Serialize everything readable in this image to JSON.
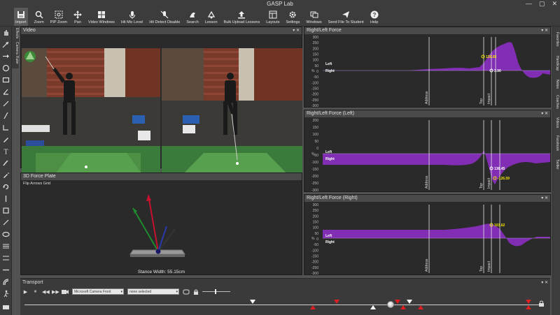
{
  "window": {
    "title": "GASP Lab",
    "controls": [
      "—",
      "▢",
      "✕"
    ]
  },
  "toolbar": {
    "items": [
      {
        "label": "Import",
        "icon": "save-icon"
      },
      {
        "label": "Zoom",
        "icon": "zoom-icon"
      },
      {
        "label": "PIP Zoom",
        "icon": "pip-zoom-icon"
      },
      {
        "label": "Pan",
        "icon": "pan-icon"
      },
      {
        "label": "Video Windows",
        "icon": "video-windows-icon"
      },
      {
        "label": "Hit Mic Level",
        "icon": "mic-icon"
      },
      {
        "label": "Hit Detect Disable",
        "icon": "hit-detect-icon"
      },
      {
        "label": "Search",
        "icon": "search-icon"
      },
      {
        "label": "Lesson",
        "icon": "lesson-icon"
      },
      {
        "label": "Bulk Upload Lessons",
        "icon": "upload-icon"
      },
      {
        "label": "Layouts",
        "icon": "layouts-icon"
      },
      {
        "label": "Settings",
        "icon": "gear-icon"
      },
      {
        "label": "Windows",
        "icon": "windows-icon"
      },
      {
        "label": "Send File To Student",
        "icon": "send-icon"
      },
      {
        "label": "Help",
        "icon": "help-icon"
      }
    ]
  },
  "left_vtabs": [
    "Effects",
    "Camera",
    "Ruler"
  ],
  "right_vtabs": [
    "Favorites",
    "Handicap",
    "Notes",
    "Coaches",
    "Videos",
    "Facebook",
    "Twitter"
  ],
  "video_panel": {
    "title": "Video"
  },
  "force_plate": {
    "title": "3D Force Plate",
    "options": "Flip Arrows  Grid",
    "stance": "Stance Width: 55.15cm"
  },
  "charts": [
    {
      "title": "Right/Left Force",
      "ylabel": "%",
      "y_ticks": [
        "300",
        "250",
        "200",
        "150",
        "100",
        "50",
        "0",
        "-50",
        "-100",
        "-150",
        "-200",
        "-250",
        "-300"
      ],
      "series_labels": [
        "Left",
        "Right"
      ],
      "events": [
        "Address",
        "Top",
        "Impact"
      ],
      "values": [
        {
          "text": "139.55",
          "color": "#f2e600"
        },
        {
          "text": "3.90",
          "color": "#ffffff"
        }
      ]
    },
    {
      "title": "Right/Left Force (Left)",
      "ylabel": "%",
      "y_ticks": [
        "200",
        "150",
        "100",
        "50",
        "0",
        "-50",
        "-100",
        "-150",
        "-200",
        "-250",
        "-300"
      ],
      "series_labels": [
        "Left",
        "Right"
      ],
      "events": [
        "Address",
        "Top",
        "Impact"
      ],
      "values": [
        {
          "text": "138.45",
          "color": "#ffffff"
        },
        {
          "text": "-126.59",
          "color": "#f2e600"
        }
      ]
    },
    {
      "title": "Right/Left Force (Right)",
      "ylabel": "%",
      "y_ticks": [
        "300",
        "250",
        "200",
        "150",
        "100",
        "50",
        "0",
        "-50",
        "-100",
        "-150",
        "-200",
        "-250",
        "-300"
      ],
      "series_labels": [
        "Left",
        "Right"
      ],
      "events": [
        "Address",
        "Top",
        "Impact"
      ],
      "values": [
        {
          "text": "103.62",
          "color": "#f2e600"
        }
      ]
    }
  ],
  "transport": {
    "title": "Transport",
    "camera_select": "Microsoft Camera Front",
    "second_select": "none selected",
    "buttons": [
      "▶",
      "⏸",
      "◀◀",
      "▶▶"
    ]
  },
  "colors": {
    "accent": "#8a2fc0",
    "marker_red": "#e02020",
    "marker_white": "#ffffff"
  }
}
